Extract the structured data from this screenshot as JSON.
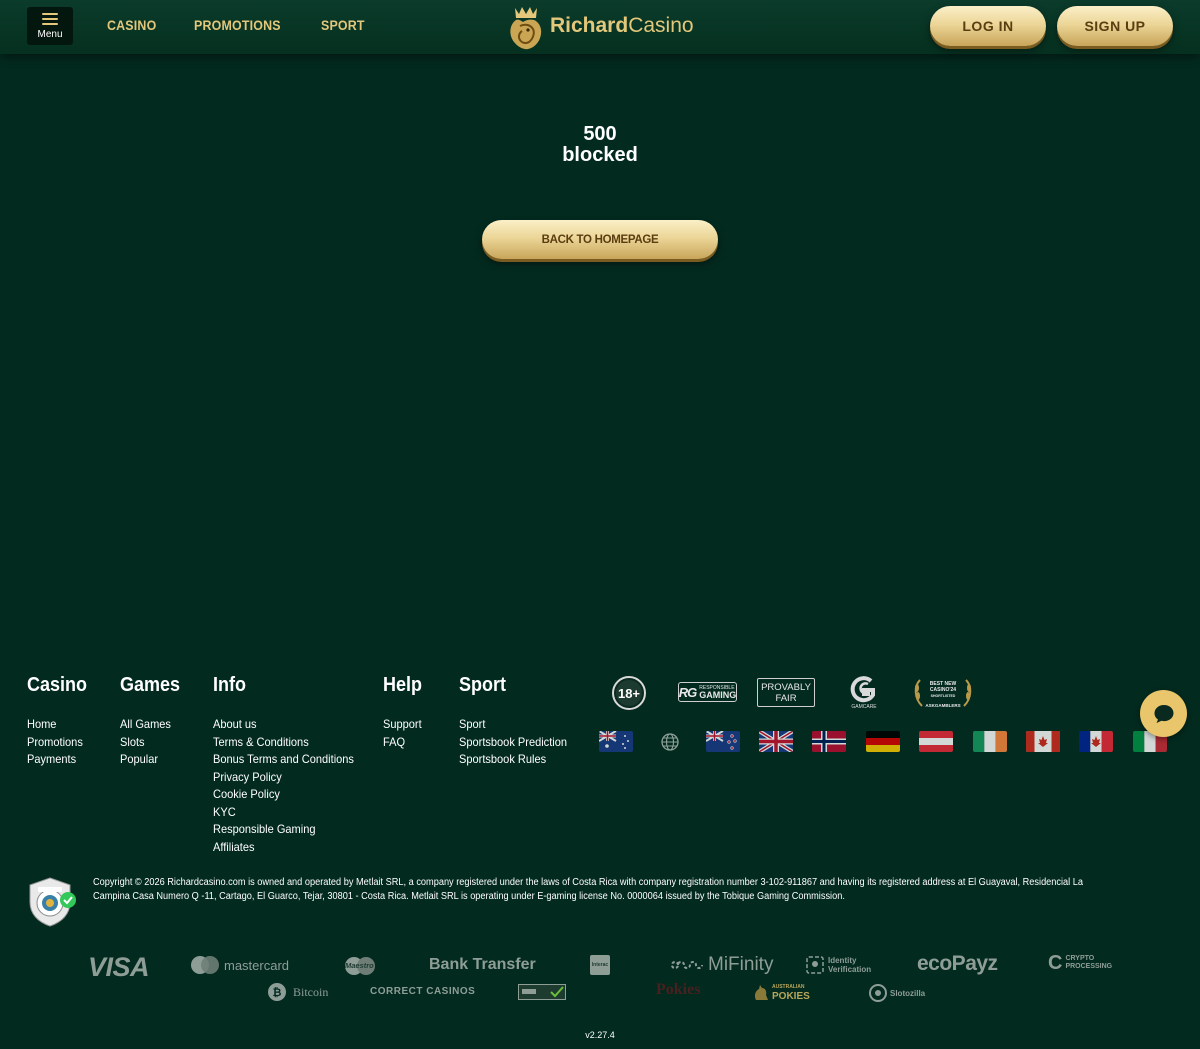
{
  "header": {
    "menu_label": "Menu",
    "nav": [
      "CASINO",
      "PROMOTIONS",
      "SPORT"
    ],
    "logo": {
      "bold": "Richard",
      "regular": "Casino"
    },
    "login": "LOG IN",
    "signup": "SIGN UP"
  },
  "error": {
    "code": "500",
    "message": "blocked",
    "button": "BACK TO HOMEPAGE"
  },
  "footer": {
    "columns": {
      "casino": {
        "title": "Casino",
        "links": [
          "Home",
          "Promotions",
          "Payments"
        ]
      },
      "games": {
        "title": "Games",
        "links": [
          "All Games",
          "Slots",
          "Popular"
        ]
      },
      "info": {
        "title": "Info",
        "links": [
          "About us",
          "Terms & Conditions",
          "Bonus Terms and Conditions",
          "Privacy Policy",
          "Cookie Policy",
          "KYC",
          "Responsible Gaming",
          "Affiliates"
        ]
      },
      "help": {
        "title": "Help",
        "links": [
          "Support",
          "FAQ"
        ]
      },
      "sport": {
        "title": "Sport",
        "links": [
          "Sport",
          "Sportsbook Prediction",
          "Sportsbook Rules"
        ]
      }
    },
    "badges": {
      "age": "18+",
      "rg_small": "RESPONSIBLE",
      "rg": "GAMING",
      "pf_line1": "PROVABLY",
      "pf_line2": "FAIR",
      "gamcare": "GAMCARE",
      "best_new_1": "BEST NEW",
      "best_new_2": "CASINO'24",
      "best_new_3": "SHORTLISTED",
      "best_new_4": "ASKGAMBLERS"
    },
    "flags": [
      "AU",
      "global",
      "NZ",
      "GB",
      "NO",
      "DE",
      "AT",
      "IE",
      "CA",
      "CA-FR",
      "IT"
    ],
    "copyright": "Copyright © 2026 Richardcasino.com is owned and operated by Metlait SRL, a company registered under the laws of Costa Rica with company registration number 3-102-911867 and having its registered address at El Guayaval, Residencial La Campina Casa Numero Q -11, Cartago, El Guarco, Tejar, 30801 - Costa Rica. Metlait SRL is operating under E-gaming license No. 0000064 issued by the Tobique Gaming Commission.",
    "payments": {
      "visa": "VISA",
      "mastercard": "mastercard",
      "maestro": "Maestro",
      "bank_transfer": "Bank Transfer",
      "interac": "Interac",
      "mifinity": "MiFinity",
      "identity_1": "Identity",
      "identity_2": "Verification",
      "ecopayz": "ecoPayz",
      "crypto_1": "CRYPTO",
      "crypto_2": "PROCESSING",
      "bitcoin": "Bitcoin",
      "correct_casinos": "CORRECT CASINOS",
      "pokies": "Pokies",
      "aus_pokies_1": "AUSTRALIAN",
      "aus_pokies_2": "POKIES",
      "slotozilla": "Slotozilla"
    },
    "version": "v2.27.4"
  },
  "colors": {
    "background": "#032a1f",
    "header": "#0b3b2b",
    "gold": "#e3c77a",
    "button_text": "#5a3d10",
    "chat": "#e9c56b"
  }
}
